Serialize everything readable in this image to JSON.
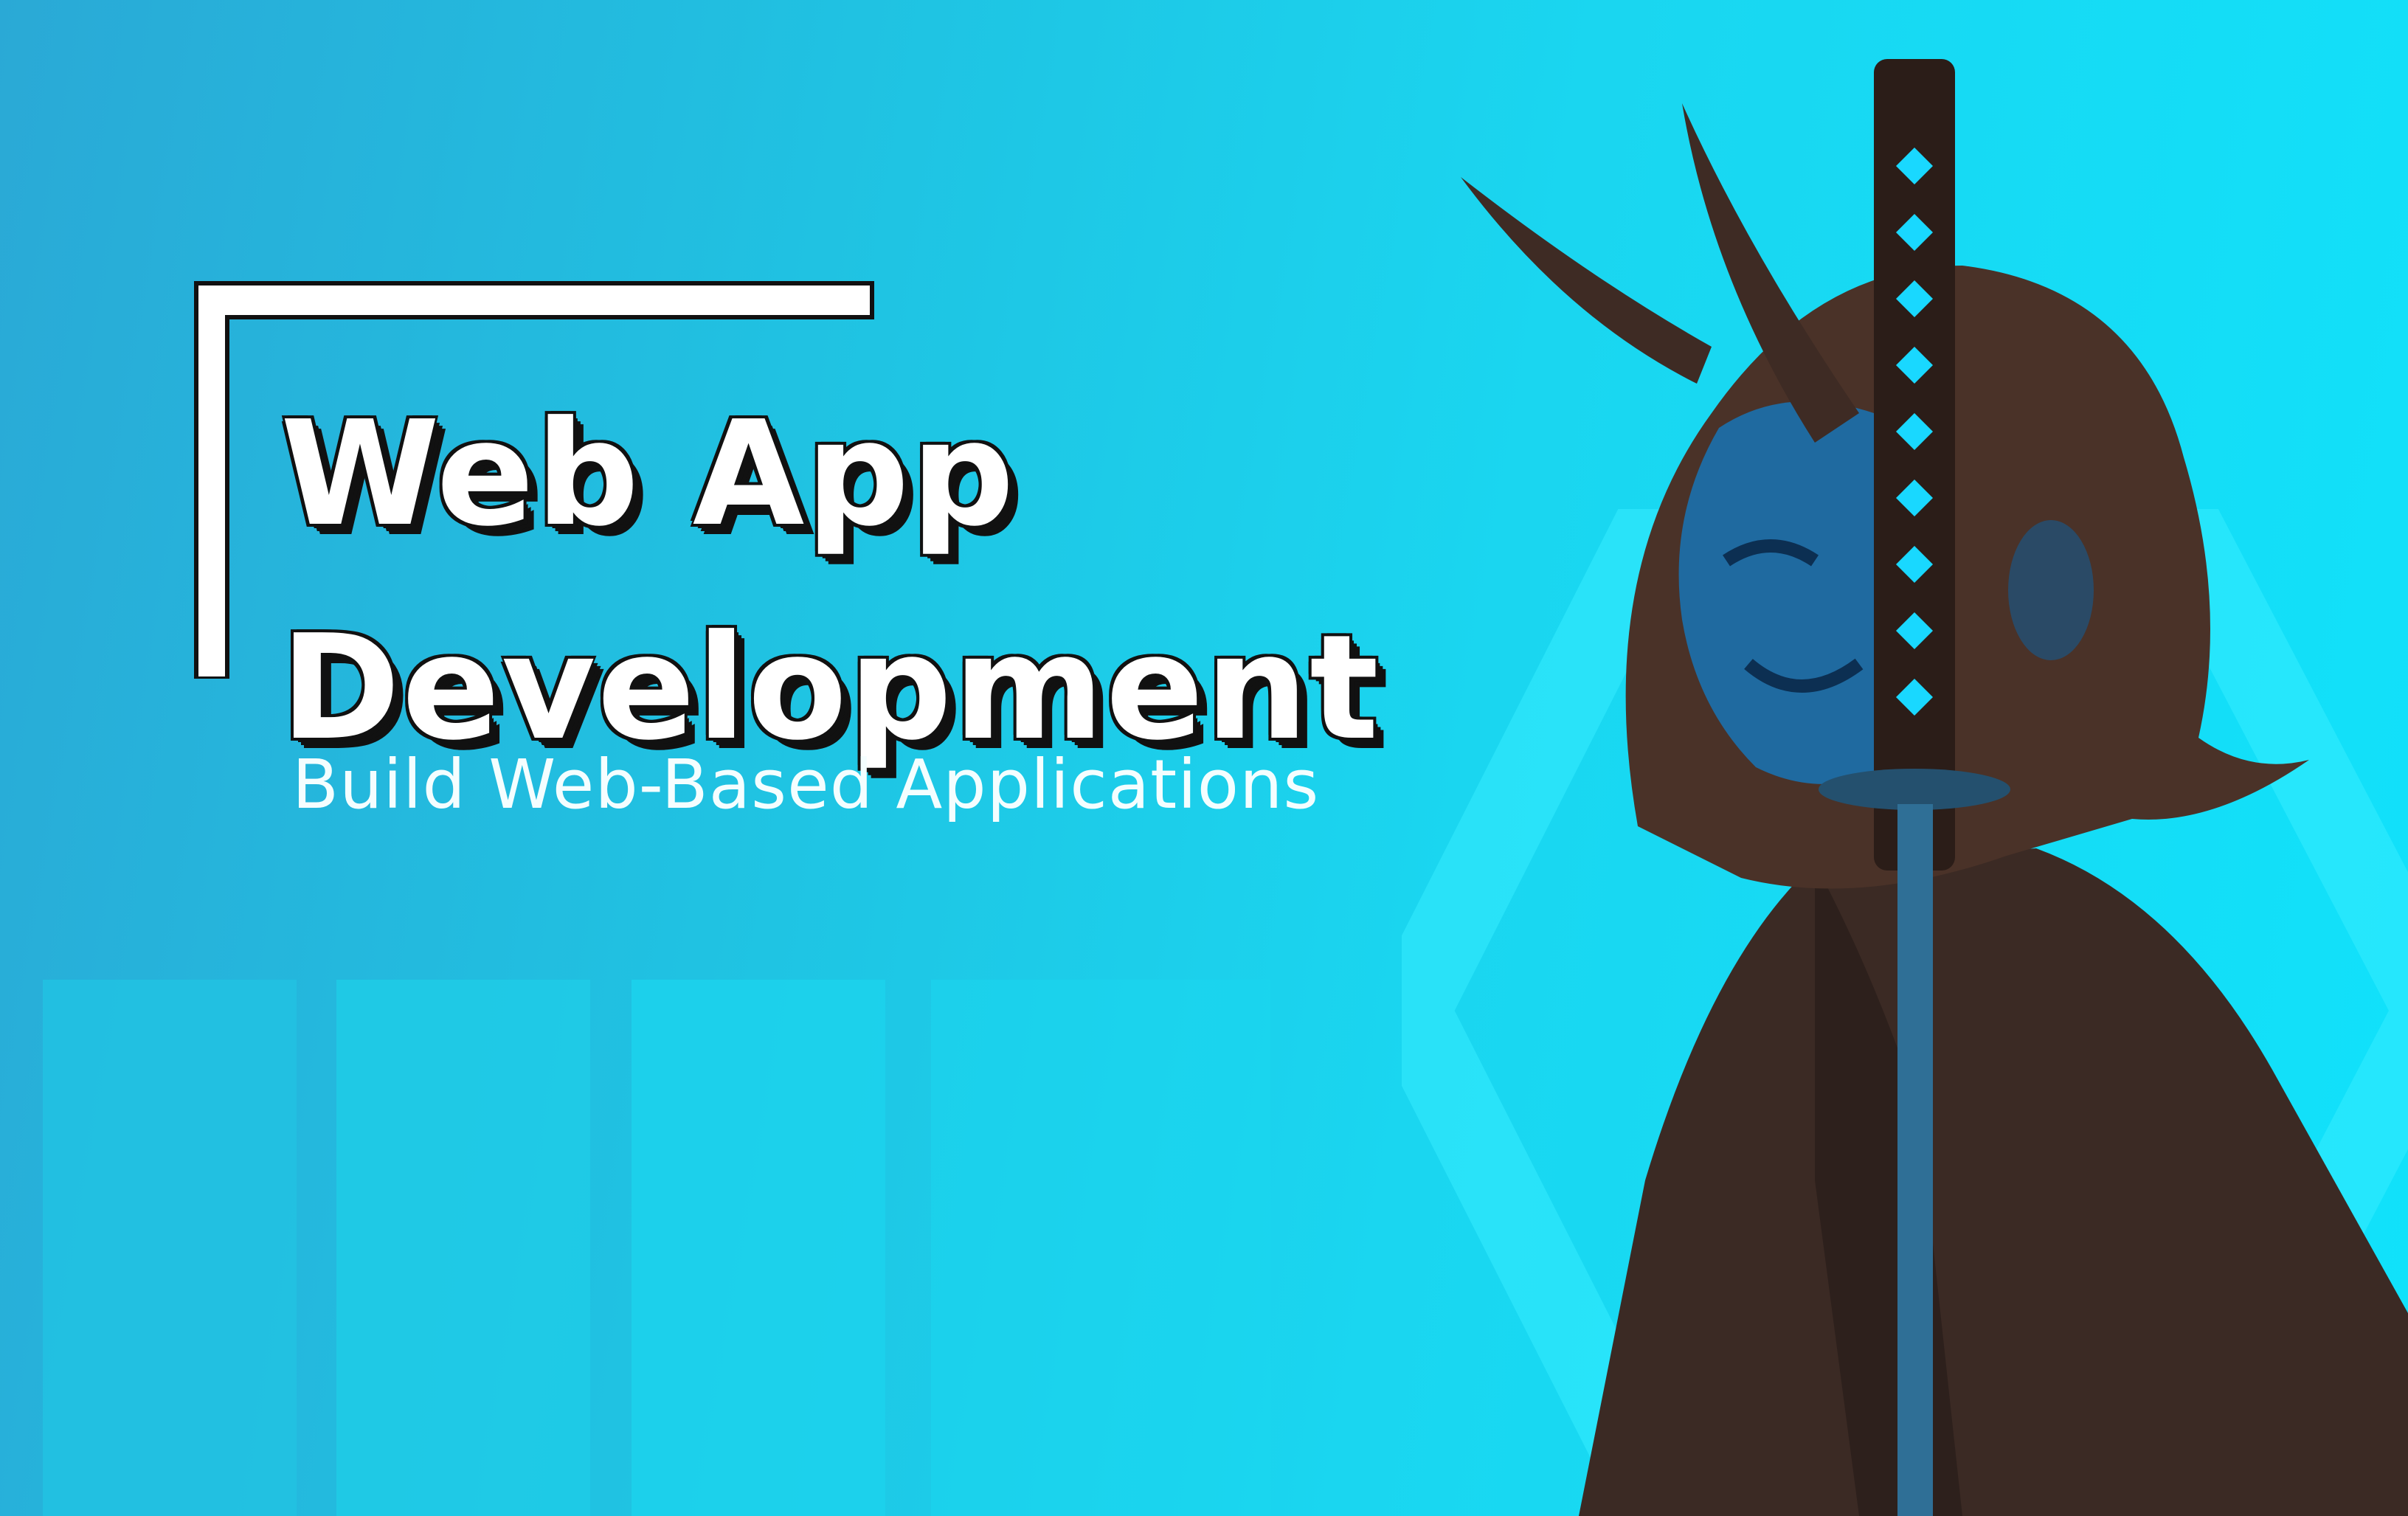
{
  "slide": {
    "title_line1": "Web App",
    "title_line2": "Development",
    "subtitle": "Build Web-Based Applications"
  },
  "colors": {
    "background_start": "#2aa9d6",
    "background_end": "#10e2fb",
    "title_fill": "#ffffff",
    "title_outline": "#111111",
    "figure_robe": "#3b2a24",
    "mask": "#1f6aa0"
  },
  "illustration": {
    "subject": "samurai-with-oni-mask-and-katana"
  }
}
